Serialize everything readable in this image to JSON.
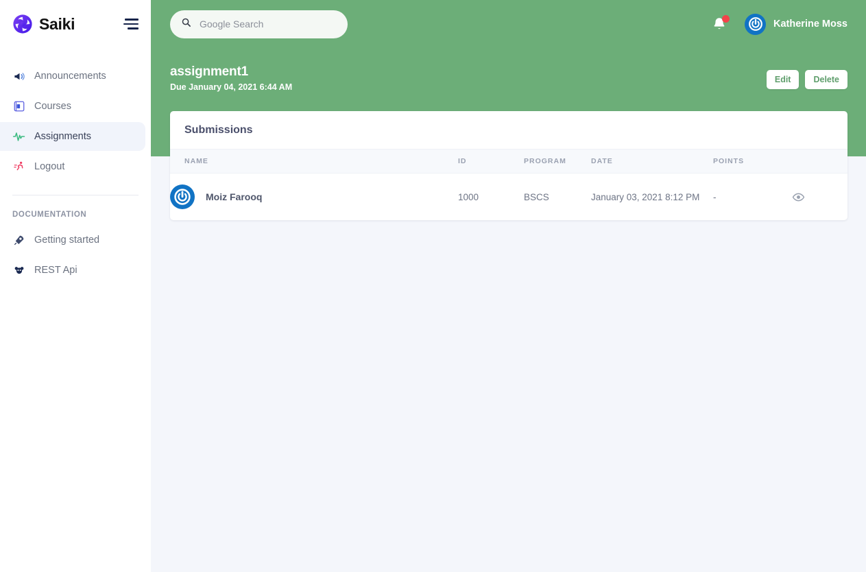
{
  "brand": {
    "name": "Saiki"
  },
  "sidebar": {
    "menu_icon": "hamburger-icon",
    "items": [
      {
        "label": "Announcements",
        "icon": "megaphone-icon",
        "active": false
      },
      {
        "label": "Courses",
        "icon": "book-icon",
        "active": false
      },
      {
        "label": "Assignments",
        "icon": "activity-pulse-icon",
        "active": true
      },
      {
        "label": "Logout",
        "icon": "running-person-icon",
        "active": false
      }
    ],
    "section_title": "DOCUMENTATION",
    "doc_items": [
      {
        "label": "Getting started",
        "icon": "rocket-icon"
      },
      {
        "label": "REST Api",
        "icon": "bug-icon"
      }
    ]
  },
  "topbar": {
    "search": {
      "placeholder": "Google Search",
      "value": "",
      "icon": "search-icon"
    },
    "notification": {
      "icon": "bell-icon",
      "has_badge": true,
      "badge_color": "#f3434a"
    },
    "user": {
      "name": "Katherine Moss",
      "avatar_icon": "power-avatar-icon",
      "avatar_color": "#1173c4"
    }
  },
  "page": {
    "title": "assignment1",
    "due_text": "Due January 04, 2021 6:44 AM",
    "edit_label": "Edit",
    "delete_label": "Delete",
    "header_color": "#6cae78"
  },
  "card": {
    "title": "Submissions",
    "columns": [
      "NAME",
      "ID",
      "PROGRAM",
      "DATE",
      "POINTS",
      ""
    ],
    "rows": [
      {
        "name": "Moiz Farooq",
        "id": "1000",
        "program": "BSCS",
        "date": "January 03, 2021 8:12 PM",
        "points": "-",
        "action_icon": "eye-icon"
      }
    ]
  }
}
